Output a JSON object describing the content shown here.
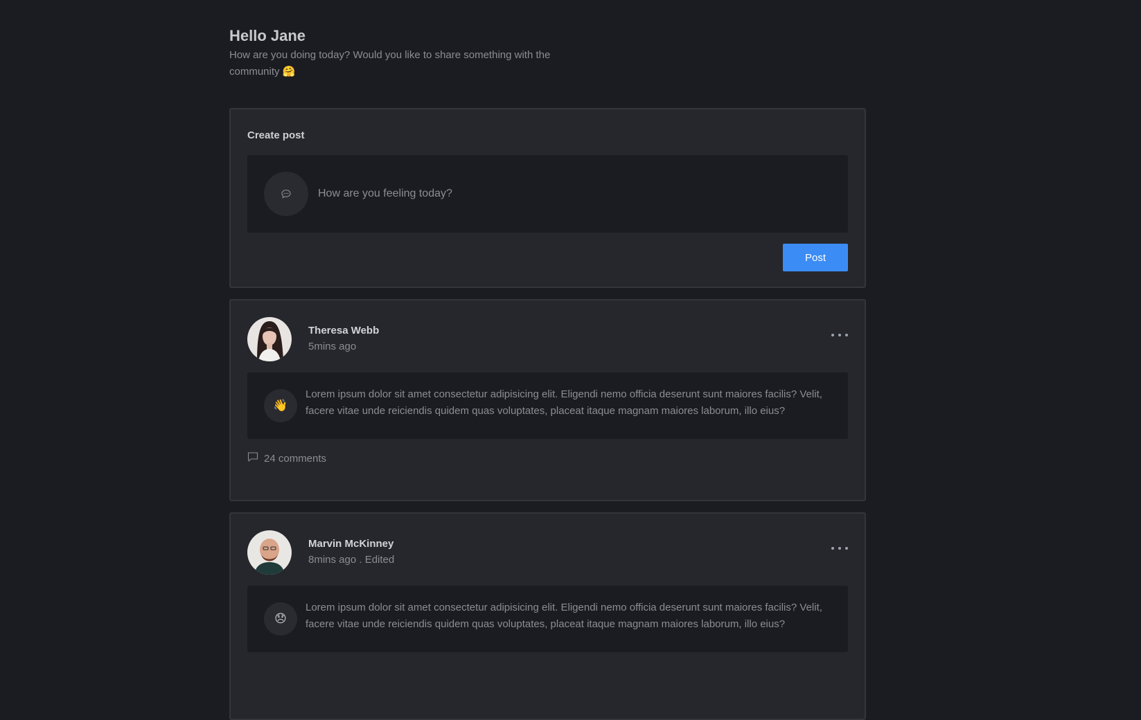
{
  "greeting": {
    "title": "Hello Jane",
    "subtitle": "How are you doing today? Would you like to share something with the community 🤗"
  },
  "create_post": {
    "title": "Create post",
    "placeholder": "How are you feeling today?",
    "post_label": "Post",
    "icon": "chat-bubble-icon"
  },
  "posts": [
    {
      "author": "Theresa Webb",
      "time": "5mins ago",
      "mood": "👋",
      "text": "Lorem ipsum dolor sit amet consectetur adipisicing elit. Eligendi nemo officia deserunt sunt maiores facilis? Velit, facere vitae unde reiciendis quidem quas voluptates, placeat itaque magnam maiores laborum, illo eius?",
      "comments": "24 comments"
    },
    {
      "author": "Marvin McKinney",
      "time": "8mins ago . Edited",
      "mood": "😞",
      "text": "Lorem ipsum dolor sit amet consectetur adipisicing elit. Eligendi nemo officia deserunt sunt maiores facilis? Velit, facere vitae unde reiciendis quidem quas voluptates, placeat itaque magnam maiores laborum, illo eius?"
    }
  ],
  "colors": {
    "background": "#1b1c21",
    "card": "#26272c",
    "accent": "#3b8cf5"
  }
}
